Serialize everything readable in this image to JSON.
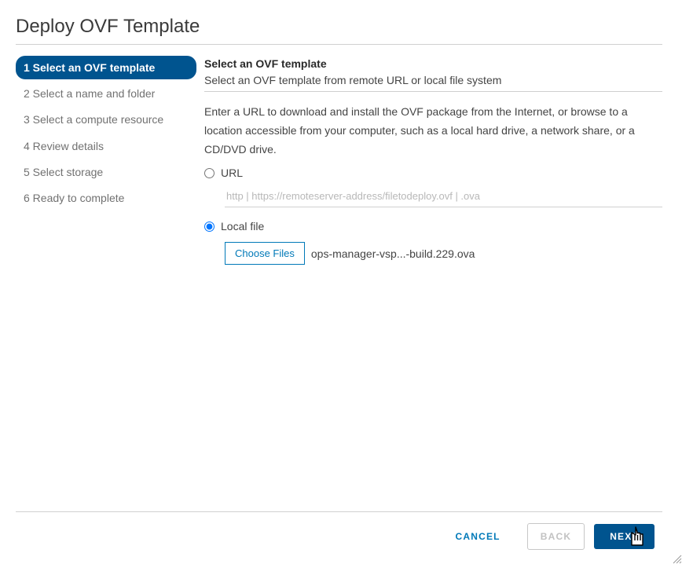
{
  "title": "Deploy OVF Template",
  "steps": [
    {
      "label": "1 Select an OVF template",
      "active": true
    },
    {
      "label": "2 Select a name and folder",
      "active": false
    },
    {
      "label": "3 Select a compute resource",
      "active": false
    },
    {
      "label": "4 Review details",
      "active": false
    },
    {
      "label": "5 Select storage",
      "active": false
    },
    {
      "label": "6 Ready to complete",
      "active": false
    }
  ],
  "panel": {
    "heading": "Select an OVF template",
    "subheading": "Select an OVF template from remote URL or local file system",
    "instruction": "Enter a URL to download and install the OVF package from the Internet, or browse to a location accessible from your computer, such as a local hard drive, a network share, or a CD/DVD drive.",
    "url_option": "URL",
    "url_placeholder": "http | https://remoteserver-address/filetodeploy.ovf | .ova",
    "local_option": "Local file",
    "choose_files_label": "Choose Files",
    "selected_file": "ops-manager-vsp...-build.229.ova",
    "selected_source": "local"
  },
  "footer": {
    "cancel": "CANCEL",
    "back": "BACK",
    "next": "NEXT"
  }
}
